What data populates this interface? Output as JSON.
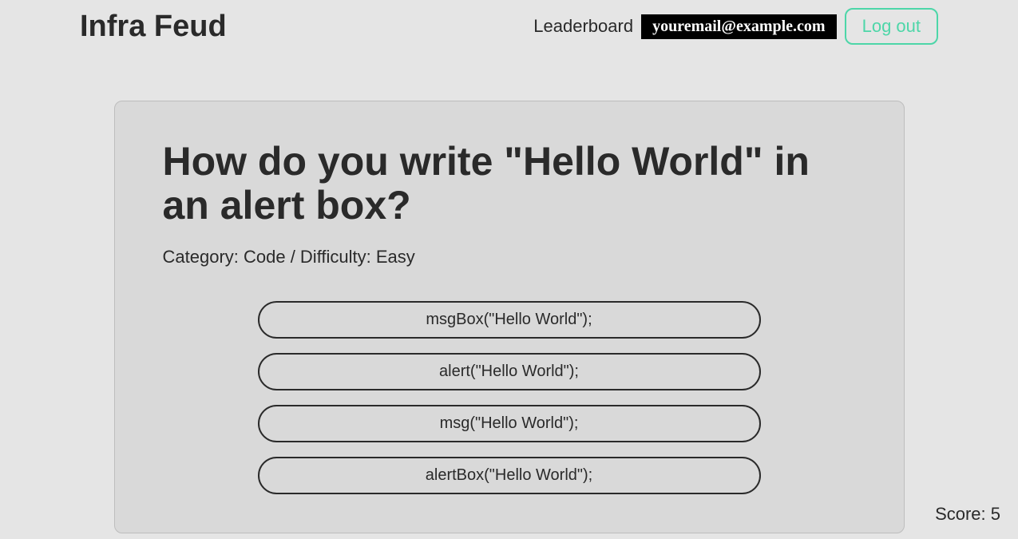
{
  "header": {
    "title": "Infra Feud",
    "leaderboard_label": "Leaderboard",
    "user_email": "youremail@example.com",
    "logout_label": "Log out"
  },
  "question": {
    "text": "How do you write \"Hello World\" in an alert box?",
    "meta": "Category: Code / Difficulty: Easy",
    "options": [
      "msgBox(\"Hello World\");",
      "alert(\"Hello World\");",
      "msg(\"Hello World\");",
      "alertBox(\"Hello World\");"
    ]
  },
  "score": {
    "label": "Score: 5"
  }
}
